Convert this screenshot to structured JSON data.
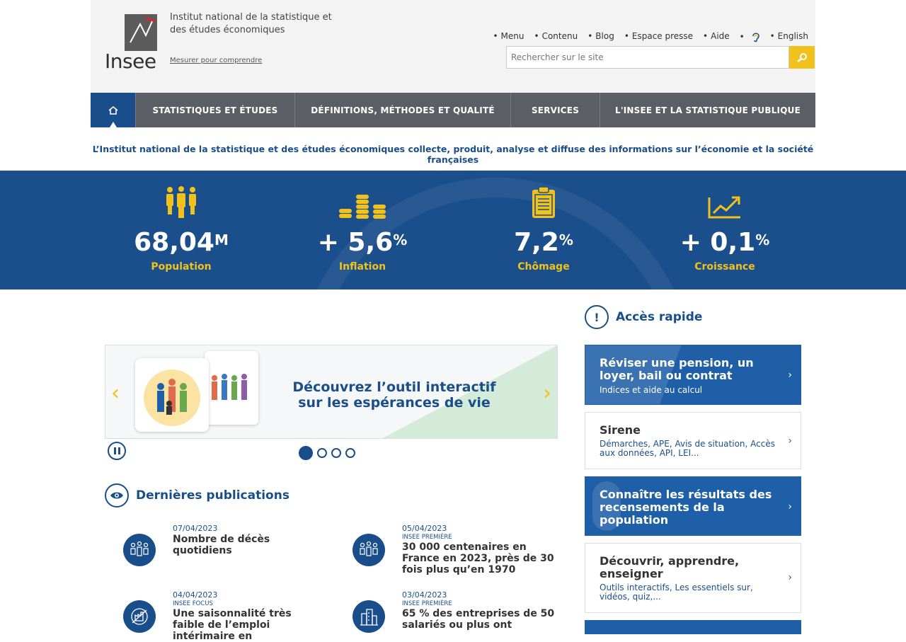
{
  "header": {
    "logo_word": "Insee",
    "institute_name": "Institut national de la statistique et des études économiques",
    "tagline": "Mesurer pour comprendre",
    "top_links": [
      "Menu",
      "Contenu",
      "Blog",
      "Espace presse",
      "Aide"
    ],
    "language_link": "English",
    "search_placeholder": "Rechercher sur le site",
    "accessibility_icon": "ear-icon"
  },
  "nav": {
    "home_icon": "home-icon",
    "items": [
      "STATISTIQUES ET ÉTUDES",
      "DÉFINITIONS, MÉTHODES ET QUALITÉ",
      "SERVICES",
      "L'INSEE ET LA STATISTIQUE PUBLIQUE"
    ]
  },
  "intro": "L’Institut national de la statistique et des études économiques collecte, produit, analyse et diffuse des informations sur l’économie et la société françaises",
  "kpis": [
    {
      "value": "68,04",
      "unit": "M",
      "label": "Population",
      "icon": "people-icon"
    },
    {
      "value": "+ 5,6",
      "unit": "%",
      "label": "Inflation",
      "icon": "coins-icon"
    },
    {
      "value": "7,2",
      "unit": "%",
      "label": "Chômage",
      "icon": "clipboard-icon"
    },
    {
      "value": "+ 0,1",
      "unit": "%",
      "label": "Croissance",
      "icon": "growth-chart-icon"
    }
  ],
  "carousel": {
    "text_line1": "Découvrez l’outil interactif",
    "text_line2": "sur les espérances de vie",
    "slides": 4,
    "active_slide": 1
  },
  "publications": {
    "title": "Dernières publications",
    "items": [
      {
        "date": "07/04/2023",
        "collection": "",
        "title": "Nombre de décès quotidiens",
        "icon": "population-icon"
      },
      {
        "date": "05/04/2023",
        "collection": "INSEE PREMIÈRE",
        "title": "30 000 centenaires en France en 2023, près de 30 fois plus qu’en 1970",
        "icon": "population-icon"
      },
      {
        "date": "04/04/2023",
        "collection": "INSEE FOCUS",
        "title": "Une saisonnalité très faible de l’emploi intérimaire en",
        "icon": "industry-chart-icon"
      },
      {
        "date": "03/04/2023",
        "collection": "INSEE PREMIÈRE",
        "title": "65 % des entreprises de 50 salariés ou plus ont",
        "icon": "buildings-icon"
      }
    ]
  },
  "quick_access": {
    "title": "Accès rapide",
    "items": [
      {
        "title": "Réviser une pension, un loyer, bail ou contrat",
        "subtitle": "Indices et aide au calcul",
        "style": "blue"
      },
      {
        "title": "Sirene",
        "subtitle": "Démarches, APE, Avis de situation, Accès aux données, API, LEI...",
        "style": "light"
      },
      {
        "title": "Connaître les résultats des recensements de la population",
        "subtitle": "",
        "style": "blue"
      },
      {
        "title": "Découvrir, apprendre, enseigner",
        "subtitle": "Outils interactifs, Les essentiels sur, vidéos, quiz,...",
        "style": "light"
      }
    ]
  },
  "colors": {
    "primary": "#1a4e8a",
    "accent": "#f0c21b",
    "nav": "#5c5e66"
  }
}
